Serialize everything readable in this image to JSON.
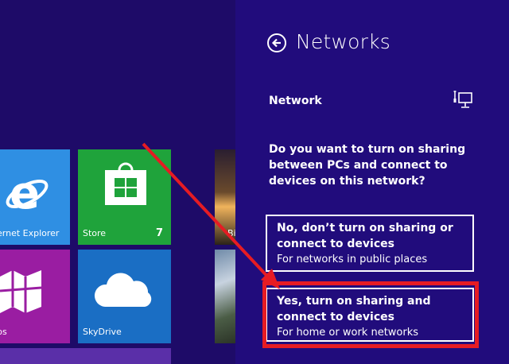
{
  "start_screen": {
    "tiles": {
      "ie": {
        "label": "ernet Explorer"
      },
      "store": {
        "label": "Store",
        "badge": "7"
      },
      "pink": {
        "label": "ps"
      },
      "skydrive": {
        "label": "SkyDrive"
      },
      "photo1": {
        "label": "Bi"
      }
    }
  },
  "panel": {
    "title": "Networks",
    "network_label": "Network",
    "question": "Do you want to turn on sharing between PCs and connect to devices on this network?",
    "options": [
      {
        "main": "No, don’t turn on sharing or connect to devices",
        "sub": "For networks in public places"
      },
      {
        "main": "Yes, turn on sharing and connect to devices",
        "sub": "For home or work networks"
      }
    ]
  },
  "colors": {
    "panel_bg": "#210c7c",
    "start_bg": "#1e0b68",
    "annotation_red": "#e61c23"
  }
}
